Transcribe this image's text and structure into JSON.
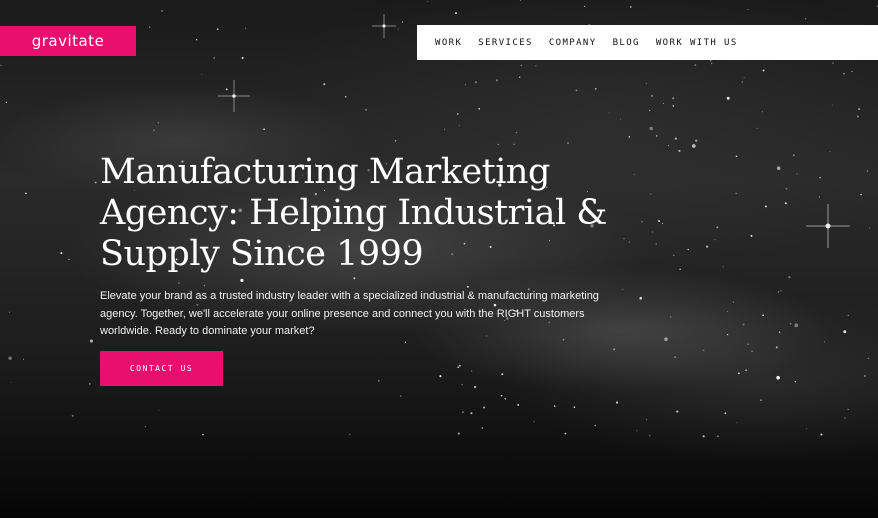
{
  "brand": {
    "logo_text": "gravitate",
    "accent_color": "#e8106f"
  },
  "nav": {
    "items": [
      {
        "label": "WORK"
      },
      {
        "label": "SERVICES"
      },
      {
        "label": "COMPANY"
      },
      {
        "label": "BLOG"
      },
      {
        "label": "WORK WITH US"
      }
    ]
  },
  "hero": {
    "headline": "Manufacturing Marketing Agency: Helping Industrial & Supply Since 1999",
    "subtext": "Elevate your brand as a trusted industry leader with a specialized industrial & manufacturing marketing agency. Together, we'll accelerate your online presence and connect you with the RIGHT customers worldwide. Ready to dominate your market?",
    "cta_label": "CONTACT US"
  }
}
